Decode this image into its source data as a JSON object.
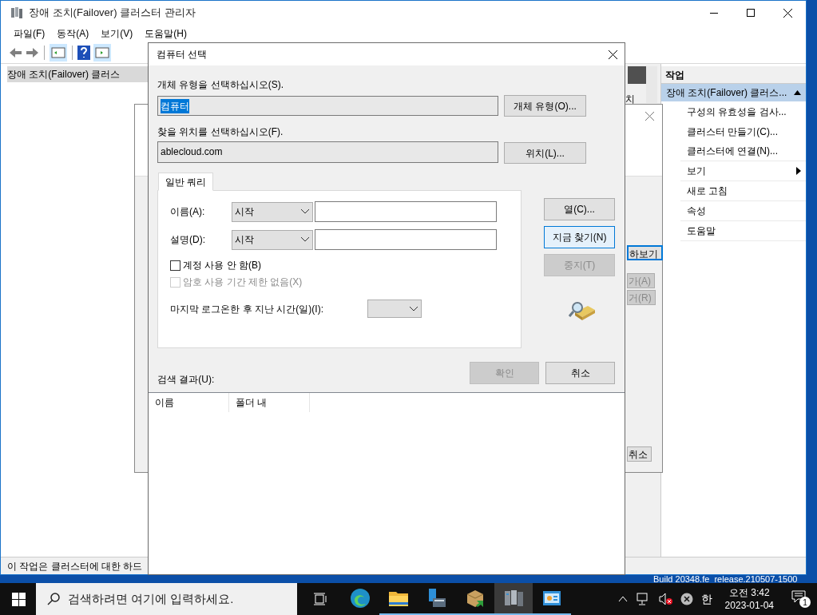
{
  "main_window": {
    "title": "장애 조치(Failover) 클러스터 관리자",
    "menu": [
      "파일(F)",
      "동작(A)",
      "보기(V)",
      "도움말(H)"
    ],
    "tree": [
      {
        "label": "장애 조치(Failover) 클러스",
        "selected": true
      }
    ],
    "middle_fragment": "치",
    "actions": {
      "header": "작업",
      "group": "장애 조치(Failover) 클러스...",
      "items": [
        {
          "label": "구성의 유효성을 검사...",
          "kind": "item"
        },
        {
          "label": "클러스터 만들기(C)...",
          "kind": "item"
        },
        {
          "label": "클러스터에 연결(N)...",
          "kind": "item"
        },
        {
          "label": "보기",
          "kind": "submenu"
        },
        {
          "label": "새로 고침",
          "kind": "item"
        },
        {
          "label": "속성",
          "kind": "item"
        },
        {
          "label": "도움말",
          "kind": "item"
        }
      ]
    },
    "status_bar": "이 작업은 클러스터에 대한 하드"
  },
  "wizard_fragments": [
    {
      "label": "하보기",
      "disabled": false,
      "focused": true
    },
    {
      "label": "가(A)",
      "disabled": true,
      "focused": false
    },
    {
      "label": "거(R)",
      "disabled": true,
      "focused": false
    },
    {
      "label": "취소",
      "disabled": false,
      "focused": false
    }
  ],
  "dialog": {
    "title": "컴퓨터 선택",
    "object_type": {
      "label": "개체 유형을 선택하십시오(S).",
      "value": "컴퓨터",
      "button": "개체 유형(O)..."
    },
    "location": {
      "label": "찾을 위치를 선택하십시오(F).",
      "value": "ablecloud.com",
      "button": "위치(L)..."
    },
    "tabs": [
      {
        "label": "일반 쿼리",
        "selected": true
      }
    ],
    "fields": [
      {
        "label": "이름(A):",
        "operator": "시작"
      },
      {
        "label": "설명(D):",
        "operator": "시작"
      }
    ],
    "checkboxes": [
      {
        "label": "계정 사용 안 함(B)",
        "checked": false,
        "disabled": false
      },
      {
        "label": "암호 사용 기간 제한 없음(X)",
        "checked": false,
        "disabled": true
      }
    ],
    "last_logon_label": "마지막 로그온한 후 지난 시간(일)(I):",
    "side_buttons": [
      {
        "label": "열(C)...",
        "disabled": false,
        "focused": false
      },
      {
        "label": "지금 찾기(N)",
        "disabled": false,
        "focused": true
      },
      {
        "label": "중지(T)",
        "disabled": true,
        "focused": false
      }
    ],
    "ok": {
      "label": "확인",
      "disabled": true
    },
    "cancel": {
      "label": "취소",
      "disabled": false
    },
    "results_label": "검색 결과(U):",
    "columns": [
      "이름",
      "폴더 내"
    ]
  },
  "desktop_text": "Build 20348.fe_release.210507-1500",
  "taskbar": {
    "search_placeholder": "검색하려면 여기에 입력하세요.",
    "ime": "한",
    "time": "오전 3:42",
    "date": "2023-01-04",
    "notifications": "1",
    "apps": [
      {
        "kind": "edge",
        "active": false
      },
      {
        "kind": "folder",
        "active": false
      },
      {
        "kind": "server",
        "active": false
      },
      {
        "kind": "package",
        "active": false
      },
      {
        "kind": "cluster",
        "active": true
      },
      {
        "kind": "panel",
        "active": false
      }
    ]
  }
}
